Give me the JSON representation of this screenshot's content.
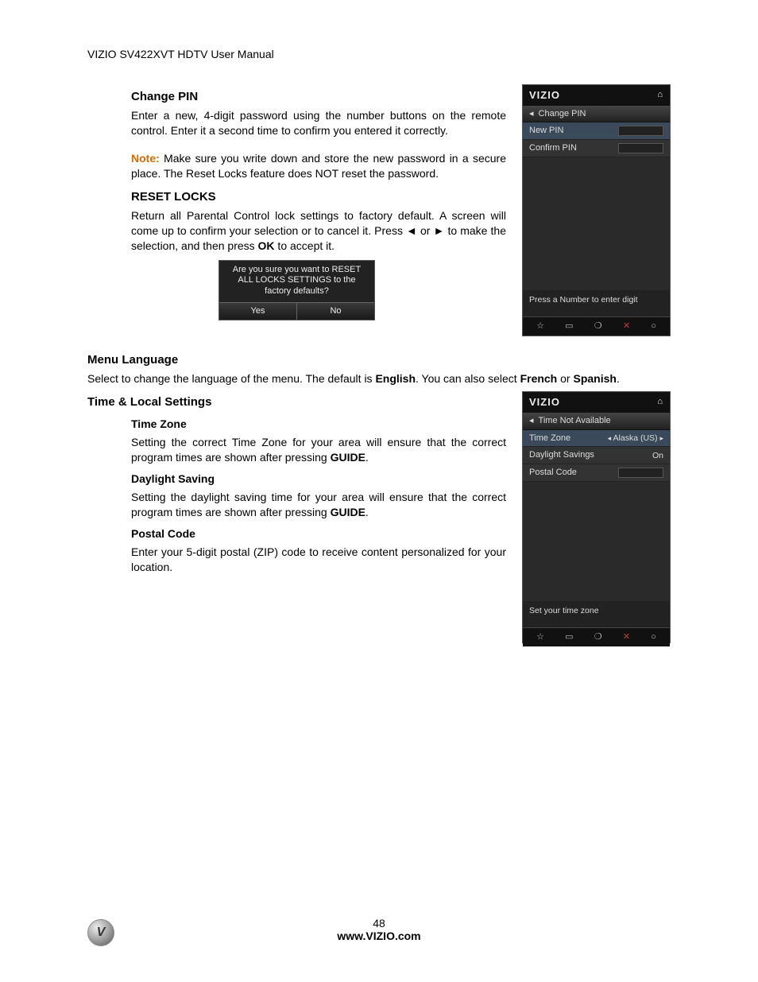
{
  "header": "VIZIO SV422XVT HDTV User Manual",
  "sections": {
    "change_pin": {
      "title": "Change PIN",
      "body": "Enter a new, 4-digit password using the number buttons on the remote control. Enter it a second time to confirm you entered it correctly.",
      "note_label": "Note:",
      "note_body": " Make sure you write down and store the new password in a secure place. The Reset Locks feature does NOT reset the password."
    },
    "reset_locks": {
      "title": "RESET LOCKS",
      "body_a": "Return all Parental Control lock settings to factory default. A screen will come up to confirm your selection or to cancel it. Press ",
      "or": " or ",
      "body_b": " to make the selection, and then press ",
      "ok": "OK",
      "body_c": " to accept it.",
      "confirm_title": "Are you sure you want to RESET ALL LOCKS SETTINGS to the factory defaults?",
      "yes": "Yes",
      "no": "No"
    },
    "menu_language": {
      "title": "Menu Language",
      "body_a": "Select to change the language of the menu. The default is ",
      "english": "English",
      "body_b": ". You can also select ",
      "french": "French",
      "body_c": " or ",
      "spanish": "Spanish",
      "body_d": "."
    },
    "time_local": {
      "title": "Time & Local Settings",
      "tz_title": "Time Zone",
      "tz_body_a": "Setting the correct Time Zone for your area will ensure that the correct program times are shown after pressing ",
      "guide": "GUIDE",
      "tz_body_b": ".",
      "ds_title": "Daylight Saving",
      "ds_body_a": "Setting the daylight saving time for your area will ensure that the correct program times are shown after pressing ",
      "ds_body_b": ".",
      "pc_title": "Postal Code",
      "pc_body": "Enter your 5-digit postal (ZIP) code to receive content personalized for your location."
    }
  },
  "screenshot1": {
    "logo": "VIZIO",
    "title": "Change PIN",
    "row1": "New PIN",
    "row2": "Confirm PIN",
    "help": "Press a Number to enter digit"
  },
  "screenshot2": {
    "logo": "VIZIO",
    "title": "Time Not Available",
    "row1_label": "Time Zone",
    "row1_value": "Alaska (US)",
    "row2_label": "Daylight Savings",
    "row2_value": "On",
    "row3_label": "Postal Code",
    "help": "Set your time zone"
  },
  "footer": {
    "page": "48",
    "url": "www.VIZIO.com"
  },
  "glyphs": {
    "home": "⌂",
    "left": "◄",
    "right": "►",
    "tri_l": "◂",
    "tri_r": "▸",
    "star": "☆",
    "wide": "▭",
    "q": "❍",
    "x": "✕",
    "circ": "○"
  }
}
